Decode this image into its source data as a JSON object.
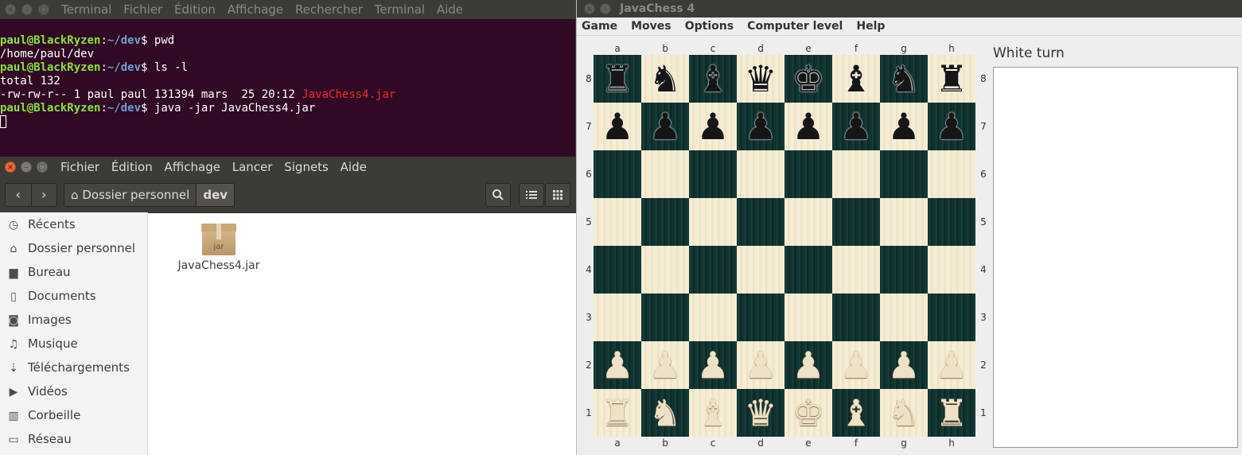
{
  "terminal": {
    "menu": [
      "Terminal",
      "Fichier",
      "Édition",
      "Affichage",
      "Rechercher",
      "Terminal",
      "Aide"
    ],
    "prompt_user": "paul@BlackRyzen",
    "prompt_sep": ":",
    "prompt_path": "~/dev",
    "prompt_end": "$ ",
    "cmd1": "pwd",
    "out1": "/home/paul/dev",
    "cmd2": "ls -l",
    "out2": "total 132",
    "out3_prefix": "-rw-rw-r-- 1 paul paul 131394 mars  25 20:12 ",
    "out3_file": "JavaChess4.jar",
    "cmd3": "java -jar JavaChess4.jar"
  },
  "files": {
    "menu": [
      "Fichier",
      "Édition",
      "Affichage",
      "Lancer",
      "Signets",
      "Aide"
    ],
    "back_icon": "‹",
    "forward_icon": "›",
    "breadcrumb_home": "Dossier personnel",
    "breadcrumb_current": "dev",
    "sidebar": [
      {
        "icon": "clock-icon",
        "glyph": "◷",
        "label": "Récents"
      },
      {
        "icon": "home-icon",
        "glyph": "⌂",
        "label": "Dossier personnel"
      },
      {
        "icon": "folder-icon",
        "glyph": "▆",
        "label": "Bureau"
      },
      {
        "icon": "document-icon",
        "glyph": "▯",
        "label": "Documents"
      },
      {
        "icon": "camera-icon",
        "glyph": "◙",
        "label": "Images"
      },
      {
        "icon": "music-icon",
        "glyph": "♫",
        "label": "Musique"
      },
      {
        "icon": "download-icon",
        "glyph": "⇣",
        "label": "Téléchargements"
      },
      {
        "icon": "video-icon",
        "glyph": "▶",
        "label": "Vidéos"
      },
      {
        "icon": "trash-icon",
        "glyph": "▥",
        "label": "Corbeille"
      },
      {
        "icon": "network-icon",
        "glyph": "▭",
        "label": "Réseau"
      }
    ],
    "file": {
      "name": "JavaChess4.jar",
      "badge": "jar"
    }
  },
  "javachess": {
    "title": "JavaChess 4",
    "menu": [
      "Game",
      "Moves",
      "Options",
      "Computer level",
      "Help"
    ],
    "files": [
      "a",
      "b",
      "c",
      "d",
      "e",
      "f",
      "g",
      "h"
    ],
    "ranks": [
      "8",
      "7",
      "6",
      "5",
      "4",
      "3",
      "2",
      "1"
    ],
    "turn": "White turn",
    "position": [
      [
        "♜",
        "♞",
        "♝",
        "♛",
        "♚",
        "♝",
        "♞",
        "♜"
      ],
      [
        "♟",
        "♟",
        "♟",
        "♟",
        "♟",
        "♟",
        "♟",
        "♟"
      ],
      [
        "",
        "",
        "",
        "",
        "",
        "",
        "",
        ""
      ],
      [
        "",
        "",
        "",
        "",
        "",
        "",
        "",
        ""
      ],
      [
        "",
        "",
        "",
        "",
        "",
        "",
        "",
        ""
      ],
      [
        "",
        "",
        "",
        "",
        "",
        "",
        "",
        ""
      ],
      [
        "♟",
        "♟",
        "♟",
        "♟",
        "♟",
        "♟",
        "♟",
        "♟"
      ],
      [
        "♜",
        "♞",
        "♝",
        "♛",
        "♚",
        "♝",
        "♞",
        "♜"
      ]
    ],
    "colors": {
      "light_square": "#f3ead0",
      "dark_square": "#0f2f2c"
    }
  }
}
